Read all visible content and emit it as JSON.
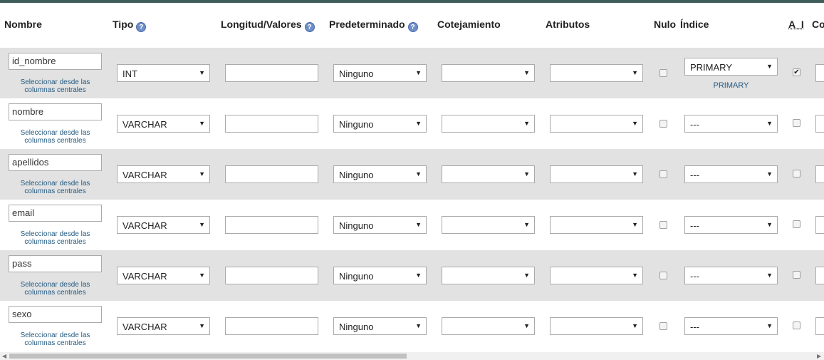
{
  "headers": {
    "nombre": "Nombre",
    "tipo": "Tipo",
    "longitud": "Longitud/Valores",
    "predeterminado": "Predeterminado",
    "cotejamiento": "Cotejamiento",
    "atributos": "Atributos",
    "nulo": "Nulo",
    "indice": "Índice",
    "ai": "A_I",
    "comentarios": "Co"
  },
  "help_icon": "?",
  "central_link": "Seleccionar desde las columnas centrales",
  "rows": [
    {
      "name": "id_nombre",
      "type": "INT",
      "length": "",
      "default": "Ninguno",
      "collation": "",
      "attributes": "",
      "null": false,
      "index": "PRIMARY",
      "index_caption": "PRIMARY",
      "ai": true
    },
    {
      "name": "nombre",
      "type": "VARCHAR",
      "length": "",
      "default": "Ninguno",
      "collation": "",
      "attributes": "",
      "null": false,
      "index": "---",
      "ai": false
    },
    {
      "name": "apellidos",
      "type": "VARCHAR",
      "length": "",
      "default": "Ninguno",
      "collation": "",
      "attributes": "",
      "null": false,
      "index": "---",
      "ai": false
    },
    {
      "name": "email",
      "type": "VARCHAR",
      "length": "",
      "default": "Ninguno",
      "collation": "",
      "attributes": "",
      "null": false,
      "index": "---",
      "ai": false
    },
    {
      "name": "pass",
      "type": "VARCHAR",
      "length": "",
      "default": "Ninguno",
      "collation": "",
      "attributes": "",
      "null": false,
      "index": "---",
      "ai": false
    },
    {
      "name": "sexo",
      "type": "VARCHAR",
      "length": "",
      "default": "Ninguno",
      "collation": "",
      "attributes": "",
      "null": false,
      "index": "---",
      "ai": false
    }
  ],
  "checkmark": "✔",
  "dropdown_arrow": "▼",
  "scroll_left": "◀",
  "scroll_right": "▶"
}
